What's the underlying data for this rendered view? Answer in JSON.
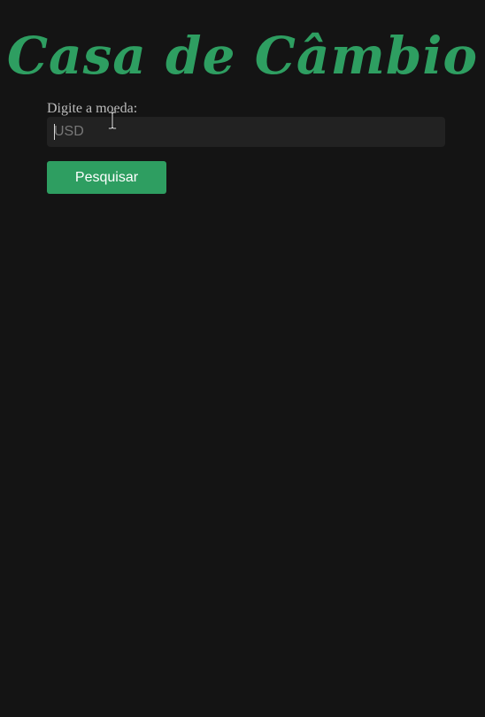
{
  "page": {
    "title": "Casa de Câmbio",
    "accent_color": "#2e9e61",
    "background_color": "#141414"
  },
  "form": {
    "label": "Digite a moeda:",
    "input_value": "",
    "input_placeholder": "USD",
    "button_label": "Pesquisar"
  },
  "pointer": {
    "icon": "text-cursor-icon"
  }
}
